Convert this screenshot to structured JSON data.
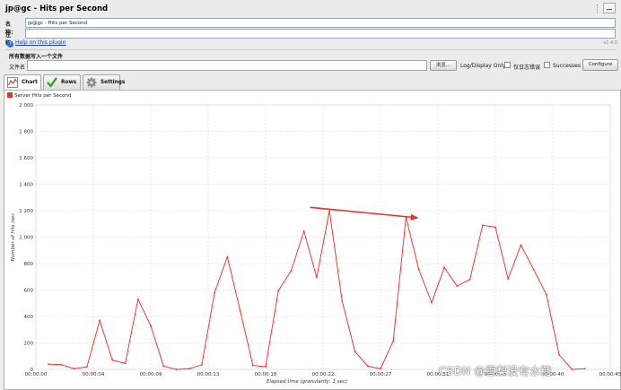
{
  "window": {
    "title": "jp@gc - Hits per Second"
  },
  "form": {
    "name_label": "名称：",
    "name_value": "jp@gc - Hits per Second",
    "comment_label": "注释：",
    "comment_value": ""
  },
  "help": {
    "icon": "?",
    "link_text": "Help on this plugin",
    "version": "v1.4.0"
  },
  "file_section": {
    "title": "所有数据写入一个文件",
    "file_label": "文件名",
    "file_value": "",
    "browse_button": "浏览...",
    "log_display_label": "Log/Display Only:",
    "errors_label": "仅日志错误",
    "successes_label": "Successes",
    "configure_button": "Configure"
  },
  "tabs": [
    {
      "label": "Chart",
      "icon": "chart-icon",
      "active": true
    },
    {
      "label": "Rows",
      "icon": "checkmark-icon",
      "active": false
    },
    {
      "label": "Settings",
      "icon": "gear-icon",
      "active": false
    }
  ],
  "watermark": "CSDN @雪梨没有水糖",
  "chart_data": {
    "type": "line",
    "title": "",
    "xlabel": "Elapsed time (granularity: 1 sec)",
    "ylabel": "Number of hits /sec",
    "ylim": [
      0,
      2000
    ],
    "yticks": [
      "0",
      "200",
      "400",
      "600",
      "800",
      "1 000",
      "1 200",
      "1 400",
      "1 600",
      "1 800",
      "2 000"
    ],
    "xticks": [
      "00:00:00",
      "00:00:04",
      "00:00:09",
      "00:00:13",
      "00:00:18",
      "00:00:22",
      "00:00:27",
      "00:00:31",
      "00:00:36",
      "00:00:40",
      "00:00:45"
    ],
    "grid": true,
    "legend_position": "top-left",
    "colors": {
      "series": "#ff2020",
      "grid": "#d8d8d8",
      "arrow": "#e8302c"
    },
    "series": [
      {
        "name": "Server Hits per Second",
        "x": [
          1,
          2,
          3,
          4,
          5,
          6,
          7,
          8,
          9,
          10,
          11,
          12,
          13,
          14,
          15,
          16,
          17,
          18,
          19,
          20,
          21,
          22,
          23,
          24,
          25,
          26,
          27,
          28,
          29,
          30,
          31,
          32,
          33,
          34,
          35,
          36,
          37,
          38,
          39,
          40,
          41,
          42,
          43
        ],
        "values": [
          40,
          35,
          5,
          20,
          370,
          70,
          45,
          530,
          330,
          25,
          0,
          5,
          35,
          580,
          850,
          445,
          30,
          20,
          595,
          745,
          1045,
          695,
          1200,
          515,
          135,
          25,
          5,
          215,
          1150,
          755,
          505,
          770,
          630,
          680,
          1090,
          1075,
          685,
          940,
          755,
          565,
          110,
          0,
          5
        ]
      }
    ],
    "annotation": {
      "type": "arrow",
      "x_start": 21.5,
      "y_start": 1225,
      "x_end": 30,
      "y_end": 1145
    }
  }
}
